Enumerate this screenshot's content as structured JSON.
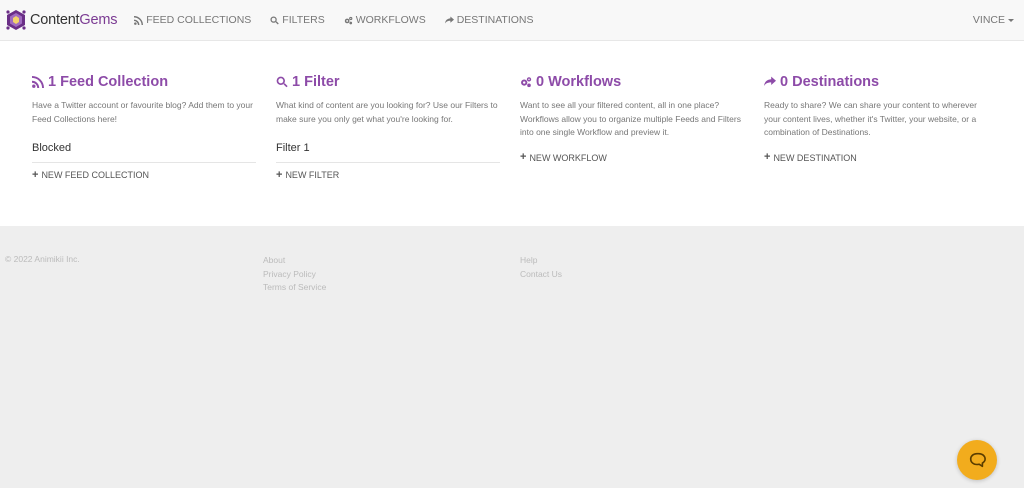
{
  "nav": {
    "brand_prefix": "Content",
    "brand_suffix": "Gems",
    "items": [
      {
        "label": "FEED COLLECTIONS",
        "icon": "rss-icon"
      },
      {
        "label": "FILTERS",
        "icon": "search-icon"
      },
      {
        "label": "WORKFLOWS",
        "icon": "gears-icon"
      },
      {
        "label": "DESTINATIONS",
        "icon": "share-icon"
      }
    ],
    "user": "VINCE"
  },
  "columns": [
    {
      "title": "1 Feed Collection",
      "icon": "rss-icon",
      "description": "Have a Twitter account or favourite blog? Add them to your Feed Collections here!",
      "entries": [
        "Blocked"
      ],
      "new_label": "NEW FEED COLLECTION"
    },
    {
      "title": "1 Filter",
      "icon": "search-icon",
      "description": "What kind of content are you looking for? Use our Filters to make sure you only get what you're looking for.",
      "entries": [
        "Filter 1"
      ],
      "new_label": "NEW FILTER"
    },
    {
      "title": "0 Workflows",
      "icon": "gears-icon",
      "description": "Want to see all your filtered content, all in one place? Workflows allow you to organize multiple Feeds and Filters into one single Workflow and preview it.",
      "entries": [],
      "new_label": "NEW WORKFLOW"
    },
    {
      "title": "0 Destinations",
      "icon": "share-icon",
      "description": "Ready to share? We can share your content to wherever your content lives, whether it's Twitter, your website, or a combination of Destinations.",
      "entries": [],
      "new_label": "NEW DESTINATION"
    }
  ],
  "footer": {
    "copyright": "© 2022 Animikii Inc.",
    "links_1": [
      "About",
      "Privacy Policy",
      "Terms of Service"
    ],
    "links_2": [
      "Help",
      "Contact Us"
    ]
  },
  "colors": {
    "accent": "#8d4ba8",
    "chat": "#f2ac1d"
  }
}
